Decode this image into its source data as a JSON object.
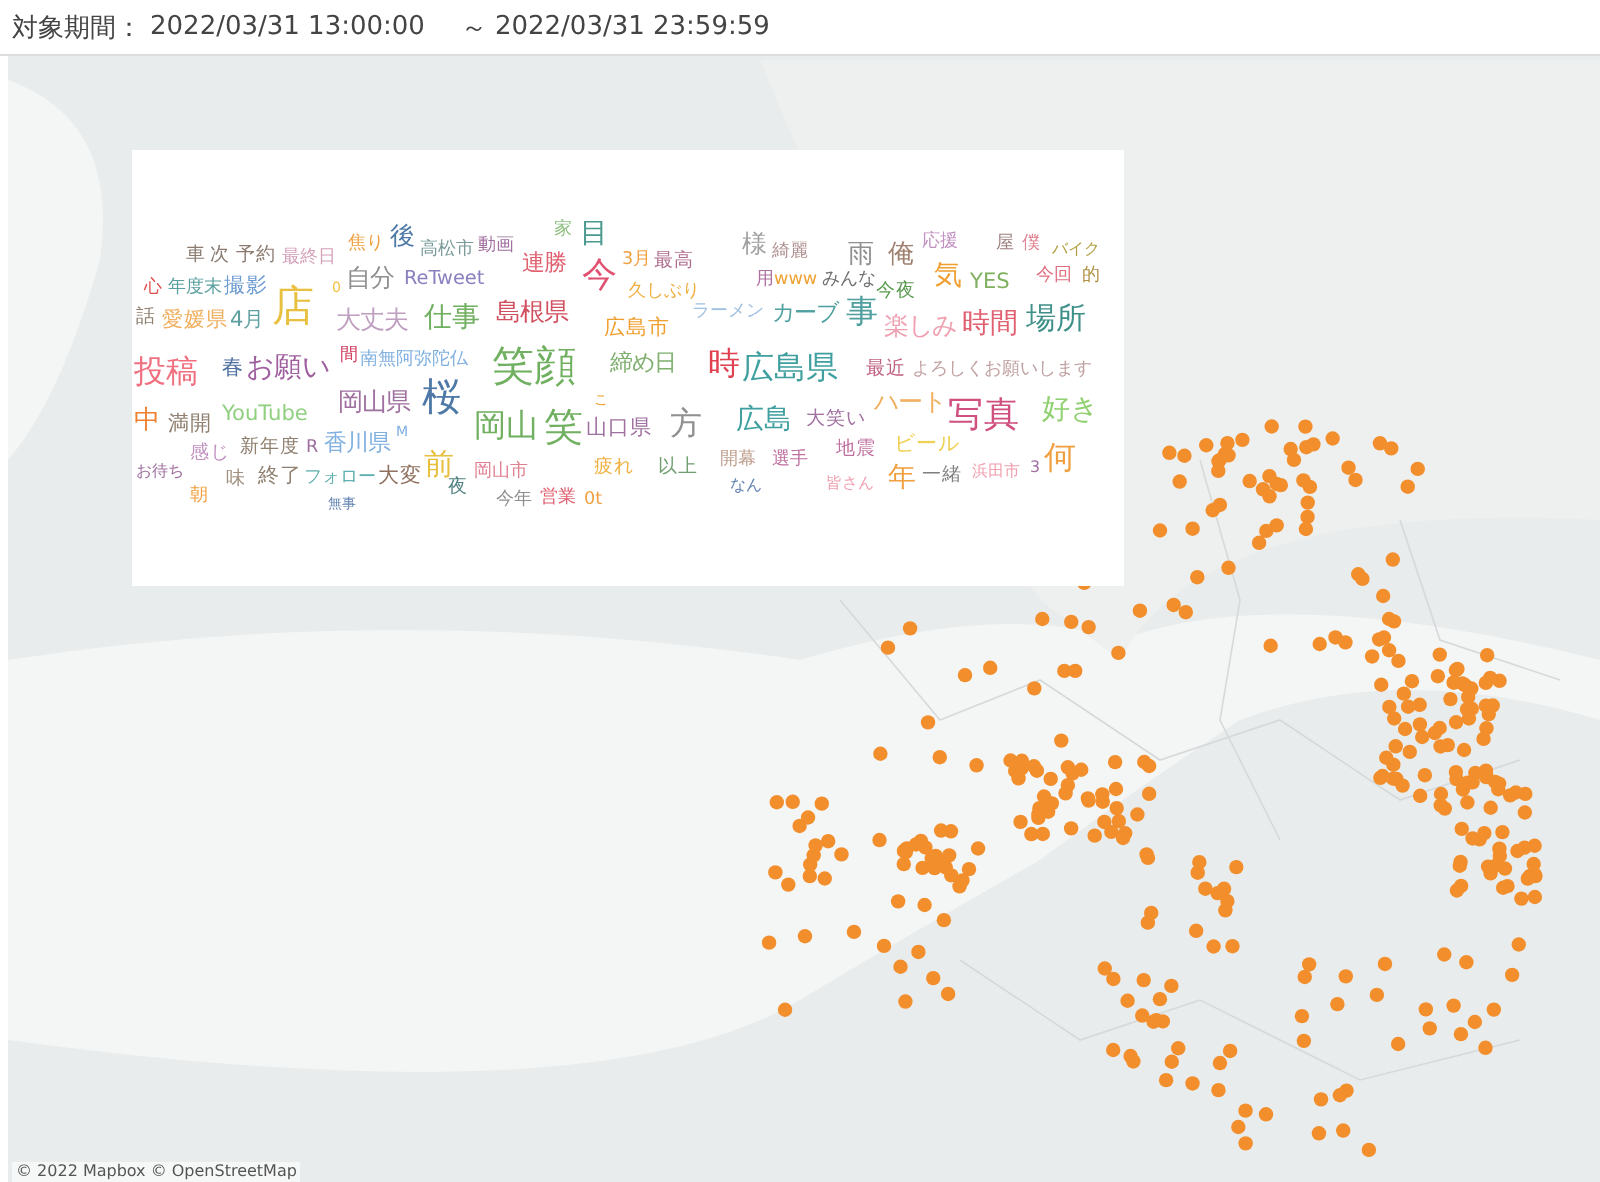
{
  "header": {
    "label": "対象期間：",
    "start": "2022/03/31 13:00:00",
    "separator": "～",
    "end": "2022/03/31 23:59:59"
  },
  "word_cloud": {
    "words": [
      {
        "text": "車",
        "color": "#8a7a70"
      },
      {
        "text": "次",
        "color": "#8a7a70"
      },
      {
        "text": "予約",
        "color": "#8a7a70"
      },
      {
        "text": "最終日",
        "color": "#d4a0b8"
      },
      {
        "text": "焦り",
        "color": "#f0a040"
      },
      {
        "text": "後",
        "color": "#4e79a7"
      },
      {
        "text": "高松市",
        "color": "#7a9a9a"
      },
      {
        "text": "動画",
        "color": "#a070a0"
      },
      {
        "text": "家",
        "color": "#8cc080"
      },
      {
        "text": "目",
        "color": "#4a9a90"
      },
      {
        "text": "連勝",
        "color": "#e06070"
      },
      {
        "text": "3月",
        "color": "#f0a040"
      },
      {
        "text": "最高",
        "color": "#b07090"
      },
      {
        "text": "様",
        "color": "#a0a0a0"
      },
      {
        "text": "綺麗",
        "color": "#b09090"
      },
      {
        "text": "雨",
        "color": "#909090"
      },
      {
        "text": "俺",
        "color": "#a08070"
      },
      {
        "text": "応援",
        "color": "#c090c0"
      },
      {
        "text": "屋",
        "color": "#a08080"
      },
      {
        "text": "僕",
        "color": "#e08090"
      },
      {
        "text": "バイク",
        "color": "#b0a040"
      },
      {
        "text": "心",
        "color": "#e05050"
      },
      {
        "text": "年度末",
        "color": "#5aa0a0"
      },
      {
        "text": "撮影",
        "color": "#6a9ad0"
      },
      {
        "text": "0",
        "color": "#f0c040"
      },
      {
        "text": "自分",
        "color": "#909090"
      },
      {
        "text": "ReTweet",
        "color": "#8a80c0"
      },
      {
        "text": "今",
        "color": "#e05070"
      },
      {
        "text": "久しぶり",
        "color": "#f0b040"
      },
      {
        "text": "用",
        "color": "#b070a0"
      },
      {
        "text": "www",
        "color": "#f0a030"
      },
      {
        "text": "みんな",
        "color": "#707070"
      },
      {
        "text": "今夜",
        "color": "#5a9a50"
      },
      {
        "text": "気",
        "color": "#f0a030"
      },
      {
        "text": "YES",
        "color": "#80b060"
      },
      {
        "text": "今回",
        "color": "#e07080"
      },
      {
        "text": "的",
        "color": "#b09040"
      },
      {
        "text": "話",
        "color": "#908070"
      },
      {
        "text": "愛媛県",
        "color": "#f0b060"
      },
      {
        "text": "4月",
        "color": "#60a0a0"
      },
      {
        "text": "店",
        "color": "#e8c040"
      },
      {
        "text": "大丈夫",
        "color": "#c0a0c0"
      },
      {
        "text": "仕事",
        "color": "#70b060"
      },
      {
        "text": "島根県",
        "color": "#d05060"
      },
      {
        "text": "広島市",
        "color": "#f0a030"
      },
      {
        "text": "ラーメン",
        "color": "#a0c0e0"
      },
      {
        "text": "カーブ",
        "color": "#50a0a0"
      },
      {
        "text": "事",
        "color": "#50a0a0"
      },
      {
        "text": "楽しみ",
        "color": "#f0a0b0"
      },
      {
        "text": "時間",
        "color": "#e06070"
      },
      {
        "text": "場所",
        "color": "#40908a"
      },
      {
        "text": "投稿",
        "color": "#f07080"
      },
      {
        "text": "春",
        "color": "#5070a0"
      },
      {
        "text": "お願い",
        "color": "#a060a0"
      },
      {
        "text": "間",
        "color": "#d04060"
      },
      {
        "text": "南無阿弥陀仏",
        "color": "#80b0e0"
      },
      {
        "text": "笑顔",
        "color": "#70b060"
      },
      {
        "text": "締め日",
        "color": "#80b070"
      },
      {
        "text": "時",
        "color": "#e04050"
      },
      {
        "text": "広島県",
        "color": "#40a0a0"
      },
      {
        "text": "最近",
        "color": "#c06080"
      },
      {
        "text": "よろしくお願いします",
        "color": "#c0a0a0"
      },
      {
        "text": "桜",
        "color": "#4e79a7"
      },
      {
        "text": "中",
        "color": "#f08030"
      },
      {
        "text": "満開",
        "color": "#908070"
      },
      {
        "text": "YouTube",
        "color": "#90d080"
      },
      {
        "text": "岡山県",
        "color": "#a070a0"
      },
      {
        "text": "岡山",
        "color": "#70b060"
      },
      {
        "text": "笑",
        "color": "#70b060"
      },
      {
        "text": "こ",
        "color": "#f0a030"
      },
      {
        "text": "山口県",
        "color": "#a070a0"
      },
      {
        "text": "方",
        "color": "#909090"
      },
      {
        "text": "広島",
        "color": "#40a0a0"
      },
      {
        "text": "大笑い",
        "color": "#a070a0"
      },
      {
        "text": "ハート",
        "color": "#f0b060"
      },
      {
        "text": "写真",
        "color": "#d05080"
      },
      {
        "text": "好き",
        "color": "#90d070"
      },
      {
        "text": "感じ",
        "color": "#c090c0"
      },
      {
        "text": "新年度",
        "color": "#908070"
      },
      {
        "text": "R",
        "color": "#a070a0"
      },
      {
        "text": "香川県",
        "color": "#80b0e0"
      },
      {
        "text": "M",
        "color": "#80b0e0"
      },
      {
        "text": "疲れ",
        "color": "#f0b040"
      },
      {
        "text": "以上",
        "color": "#70a070"
      },
      {
        "text": "開幕",
        "color": "#c0a090"
      },
      {
        "text": "選手",
        "color": "#c070a0"
      },
      {
        "text": "地震",
        "color": "#c070a0"
      },
      {
        "text": "ビール",
        "color": "#f0d050"
      },
      {
        "text": "お待ち",
        "color": "#a070a0"
      },
      {
        "text": "何",
        "color": "#f0a040"
      },
      {
        "text": "味",
        "color": "#a09080"
      },
      {
        "text": "終了",
        "color": "#908070"
      },
      {
        "text": "フォロー",
        "color": "#60b0b0"
      },
      {
        "text": "大変",
        "color": "#907060"
      },
      {
        "text": "前",
        "color": "#e8c040"
      },
      {
        "text": "夜",
        "color": "#508080"
      },
      {
        "text": "岡山市",
        "color": "#e08090"
      },
      {
        "text": "年",
        "color": "#f0a040"
      },
      {
        "text": "一緒",
        "color": "#808080"
      },
      {
        "text": "浜田市",
        "color": "#f0a0b0"
      },
      {
        "text": "3",
        "color": "#a070a0"
      },
      {
        "text": "朝",
        "color": "#f0a040"
      },
      {
        "text": "今年",
        "color": "#909090"
      },
      {
        "text": "営業",
        "color": "#e06070"
      },
      {
        "text": "0t",
        "color": "#f0a040"
      },
      {
        "text": "なん",
        "color": "#6080b0"
      },
      {
        "text": "皆さん",
        "color": "#f0a0b0"
      },
      {
        "text": "無事",
        "color": "#6080b0"
      }
    ]
  },
  "map": {
    "attribution": "© 2022 Mapbox © OpenStreetMap"
  }
}
